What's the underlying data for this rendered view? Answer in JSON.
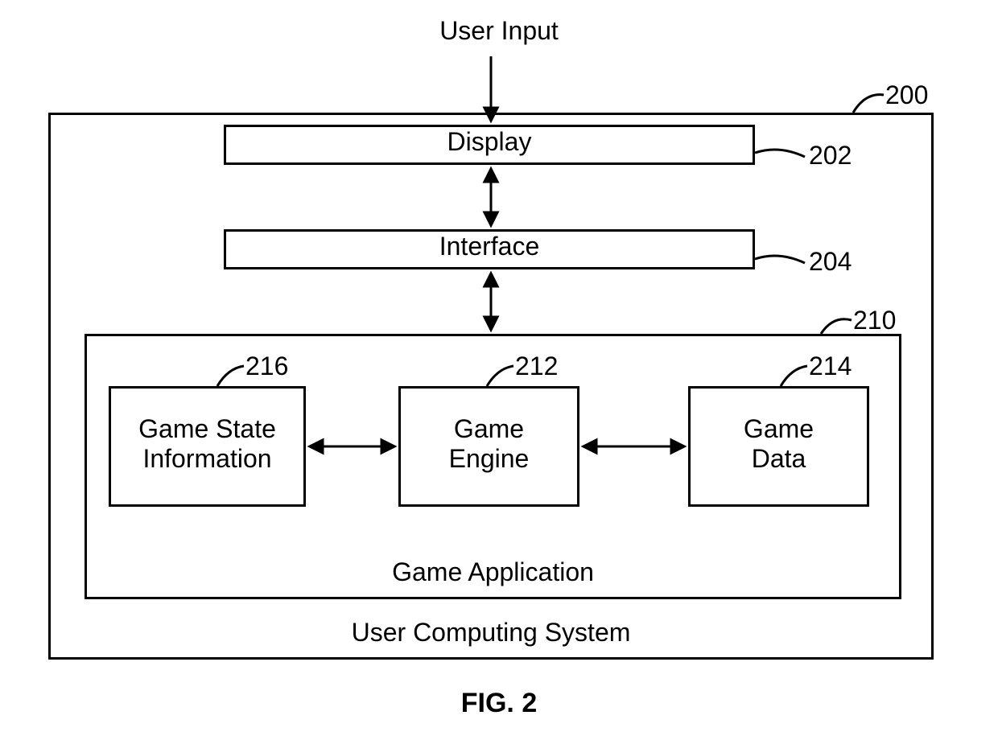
{
  "labels": {
    "user_input": "User Input",
    "display": "Display",
    "interface": "Interface",
    "game_state_info": "Game State\nInformation",
    "game_engine": "Game\nEngine",
    "game_data": "Game\nData",
    "game_application": "Game Application",
    "user_computing_system": "User Computing System",
    "figure_caption": "FIG. 2"
  },
  "reference_numerals": {
    "system": "200",
    "display": "202",
    "interface": "204",
    "game_application": "210",
    "game_engine": "212",
    "game_data": "214",
    "game_state_info": "216"
  }
}
